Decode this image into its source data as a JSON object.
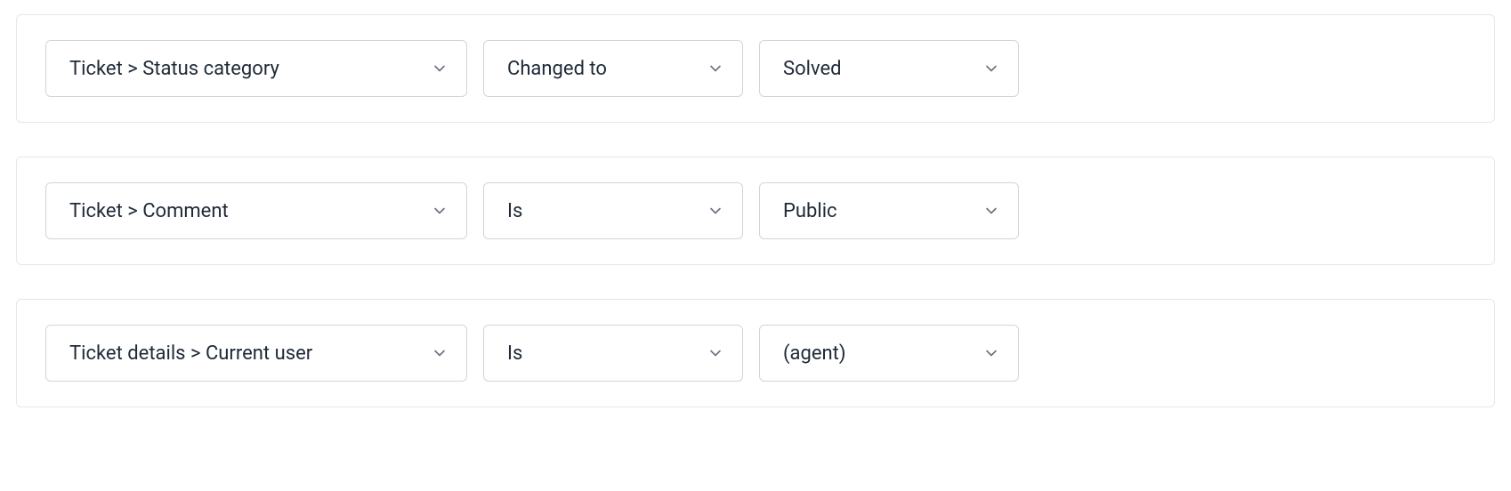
{
  "conditions": [
    {
      "field": "Ticket > Status category",
      "operator": "Changed to",
      "value": "Solved"
    },
    {
      "field": "Ticket > Comment",
      "operator": "Is",
      "value": "Public"
    },
    {
      "field": "Ticket details > Current user",
      "operator": "Is",
      "value": "(agent)"
    }
  ]
}
